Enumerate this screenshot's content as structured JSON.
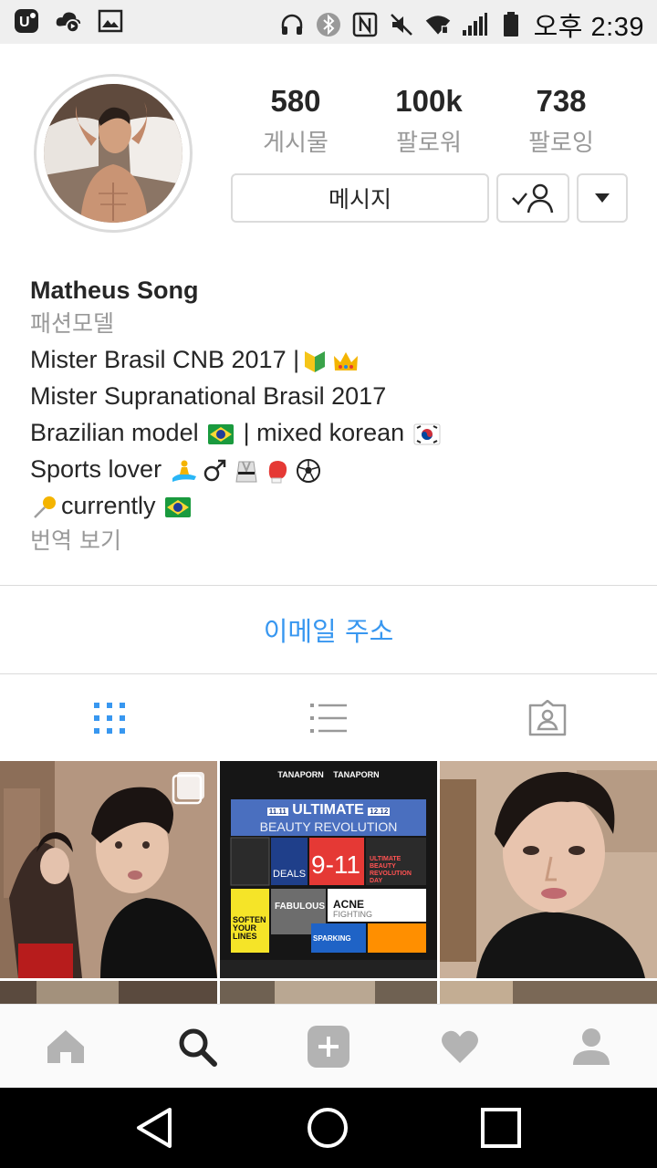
{
  "status_bar": {
    "time": "오후 2:39",
    "left_icons": [
      "ucloud-icon",
      "media-upload-icon",
      "image-icon"
    ],
    "right_icons": [
      "headset-icon",
      "bluetooth-icon",
      "nfc-icon",
      "mute-icon",
      "wifi-icon",
      "signal-icon",
      "battery-icon"
    ]
  },
  "profile": {
    "stats": [
      {
        "value": "580",
        "label": "게시물"
      },
      {
        "value": "100k",
        "label": "팔로워"
      },
      {
        "value": "738",
        "label": "팔로잉"
      }
    ],
    "message_button": "메시지",
    "name": "Matheus Song",
    "category": "패션모델",
    "bio_lines": [
      "Mister Brasil CNB 2017 |",
      "Mister Supranational Brasil 2017",
      "Brazilian model ",
      " | mixed korean ",
      "Sports lover ",
      "currently "
    ],
    "translate": "번역 보기",
    "email_button": "이메일 주소"
  },
  "tabs": [
    {
      "icon": "grid-icon",
      "active": true
    },
    {
      "icon": "list-icon",
      "active": false
    },
    {
      "icon": "tagged-icon",
      "active": false
    }
  ],
  "grid_post_2": {
    "brand_a": "TANAPORN",
    "brand_b": "TANAPORN",
    "date_left": "11.11",
    "headline": "ULTIMATE",
    "date_right": "12.12",
    "subheadline": "BEAUTY REVOLUTION",
    "big_date": "9-11",
    "deals": "DEALS",
    "fabulous": "FABULOUS",
    "acne": "ACNE",
    "fighting": "FIGHTING",
    "soften": "SOFTEN YOUR LINES",
    "sparking": "SPARKING",
    "ultimate_day": "ULTIMATE BEAUTY REVOLUTION DAY"
  },
  "bottom_nav": [
    "home-icon",
    "search-icon",
    "add-icon",
    "heart-icon",
    "profile-icon"
  ],
  "colors": {
    "accent": "#3897f0",
    "muted": "#999999",
    "border": "#dbdbdb"
  }
}
